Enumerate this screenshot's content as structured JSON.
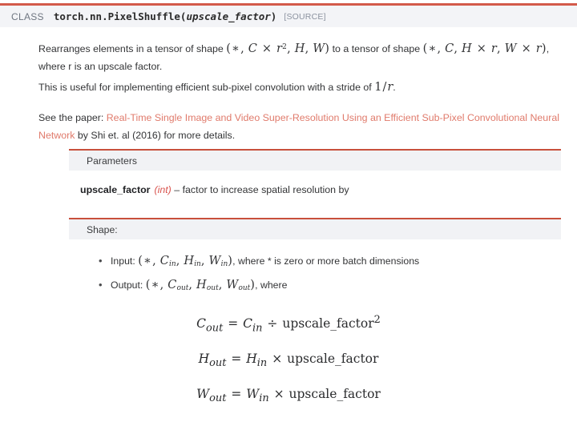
{
  "signature": {
    "class_keyword": "CLASS",
    "qualified_name": "torch.nn.PixelShuffle(",
    "parameter": "upscale_factor",
    "close_paren": ")",
    "source_link": "[SOURCE]"
  },
  "description": {
    "paragraph1_prefix": "Rearranges elements in a tensor of shape ",
    "paragraph1_math1": "(∗, C × r², H, W)",
    "paragraph1_middle": " to a tensor of shape ",
    "paragraph1_math2": "(∗, C, H × r, W × r)",
    "paragraph1_suffix": ", where r is an upscale factor.",
    "paragraph2_prefix": "This is useful for implementing efficient sub-pixel convolution with a stride of ",
    "paragraph2_math": "1/r",
    "paragraph2_suffix": ".",
    "paragraph3_prefix": "See the paper: ",
    "paragraph3_link": "Real-Time Single Image and Video Super-Resolution Using an Efficient Sub-Pixel Convolutional Neural Network",
    "paragraph3_suffix": " by Shi et. al (2016) for more details."
  },
  "parameters_section": {
    "heading": "Parameters",
    "param_name": "upscale_factor",
    "param_type": "(int)",
    "param_dash": " – ",
    "param_description": "factor to increase spatial resolution by"
  },
  "shape_section": {
    "heading": "Shape:",
    "items": [
      {
        "label": "Input: ",
        "math": "(∗, C_in, H_in, W_in)",
        "tail": ", where * is zero or more batch dimensions"
      },
      {
        "label": "Output: ",
        "math": "(∗, C_out, H_out, W_out)",
        "tail": ", where"
      }
    ]
  },
  "equations": [
    {
      "lhs_base": "C",
      "lhs_sub": "out",
      "equals": "=",
      "rhs_base": "C",
      "rhs_sub": "in",
      "operator": "÷",
      "term": "upscale_factor",
      "exponent": "2"
    },
    {
      "lhs_base": "H",
      "lhs_sub": "out",
      "equals": "=",
      "rhs_base": "H",
      "rhs_sub": "in",
      "operator": "×",
      "term": "upscale_factor",
      "exponent": ""
    },
    {
      "lhs_base": "W",
      "lhs_sub": "out",
      "equals": "=",
      "rhs_base": "W",
      "rhs_sub": "in",
      "operator": "×",
      "term": "upscale_factor",
      "exponent": ""
    }
  ],
  "colors": {
    "accent_rule": "#c8503c",
    "signature_bar_bg": "#f3f4f7",
    "banner_bg": "#f1f2f5",
    "link": "#e07a6b",
    "param_type": "#d9544f",
    "source_link": "#8c93a0"
  }
}
